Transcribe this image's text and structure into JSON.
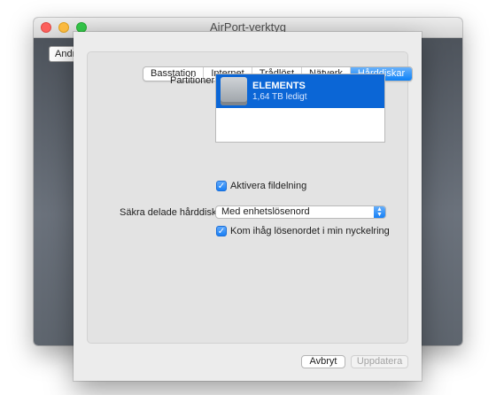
{
  "window": {
    "title": "AirPort-verktyg",
    "background_button_label": "Andra"
  },
  "tabs": [
    {
      "label": "Basstation",
      "selected": false
    },
    {
      "label": "Internet",
      "selected": false
    },
    {
      "label": "Trådlöst",
      "selected": false
    },
    {
      "label": "Nätverk",
      "selected": false
    },
    {
      "label": "Hårddiskar",
      "selected": true
    }
  ],
  "partitions": {
    "label": "Partitioner:",
    "items": [
      {
        "name": "ELEMENTS",
        "detail": "1,64 TB ledigt",
        "selected": true
      }
    ]
  },
  "file_sharing": {
    "label": "Aktivera fildelning",
    "checked": true
  },
  "secure_disks": {
    "label": "Säkra delade hårddiskar:",
    "selected_value": "Med enhetslösenord"
  },
  "keychain": {
    "label": "Kom ihåg lösenordet i min nyckelring",
    "checked": true
  },
  "buttons": {
    "cancel": "Avbryt",
    "update": "Uppdatera"
  },
  "colors": {
    "accent": "#0b66d6",
    "selected_tab": "#0d81f7",
    "disabled_text": "#a3a3a3"
  },
  "icons": {
    "checkmark": "checkmark-icon",
    "disk": "external-disk-icon",
    "popup_arrows": "up-down-chevron-icon"
  }
}
